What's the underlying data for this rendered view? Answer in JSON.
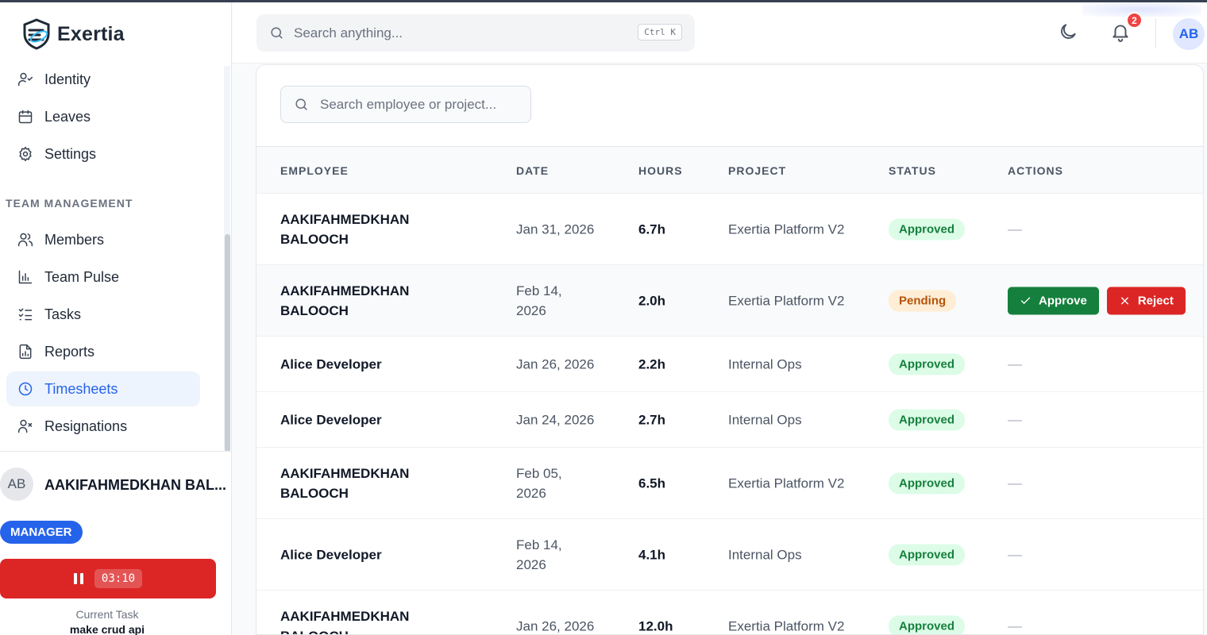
{
  "brand": {
    "name": "Exertia"
  },
  "sidebar": {
    "items_top": [
      {
        "label": "Identity",
        "icon": "user-check-icon"
      },
      {
        "label": "Leaves",
        "icon": "calendar-icon"
      },
      {
        "label": "Settings",
        "icon": "gear-icon"
      }
    ],
    "section_title": "TEAM MANAGEMENT",
    "items": [
      {
        "label": "Members",
        "icon": "users-icon"
      },
      {
        "label": "Team Pulse",
        "icon": "bar-chart-icon"
      },
      {
        "label": "Tasks",
        "icon": "list-checks-icon"
      },
      {
        "label": "Reports",
        "icon": "report-file-icon"
      },
      {
        "label": "Timesheets",
        "icon": "clock-icon",
        "active": true
      },
      {
        "label": "Resignations",
        "icon": "user-x-icon"
      }
    ],
    "user": {
      "initials": "AB",
      "name": "AAKIFAHMEDKHAN BAL...",
      "role": "MANAGER"
    },
    "timer": {
      "time": "03:10",
      "current_task_label": "Current Task",
      "current_task": "make crud api"
    }
  },
  "topbar": {
    "search_placeholder": "Search anything...",
    "shortcut": "Ctrl K",
    "notification_count": "2",
    "avatar_initials": "AB"
  },
  "table": {
    "search_placeholder": "Search employee or project...",
    "columns": [
      "EMPLOYEE",
      "DATE",
      "HOURS",
      "PROJECT",
      "STATUS",
      "ACTIONS"
    ],
    "approve_label": "Approve",
    "reject_label": "Reject",
    "rows": [
      {
        "employee": "AAKIFAHMEDKHAN BALOOCH",
        "date": "Jan 31, 2026",
        "hours": "6.7h",
        "project": "Exertia Platform V2",
        "status": "Approved"
      },
      {
        "employee": "AAKIFAHMEDKHAN BALOOCH",
        "date": "Feb 14, 2026",
        "hours": "2.0h",
        "project": "Exertia Platform V2",
        "status": "Pending"
      },
      {
        "employee": "Alice Developer",
        "date": "Jan 26, 2026",
        "hours": "2.2h",
        "project": "Internal Ops",
        "status": "Approved"
      },
      {
        "employee": "Alice Developer",
        "date": "Jan 24, 2026",
        "hours": "2.7h",
        "project": "Internal Ops",
        "status": "Approved"
      },
      {
        "employee": "AAKIFAHMEDKHAN BALOOCH",
        "date": "Feb 05, 2026",
        "hours": "6.5h",
        "project": "Exertia Platform V2",
        "status": "Approved"
      },
      {
        "employee": "Alice Developer",
        "date": "Feb 14, 2026",
        "hours": "4.1h",
        "project": "Internal Ops",
        "status": "Approved"
      },
      {
        "employee": "AAKIFAHMEDKHAN BALOOCH",
        "date": "Jan 26, 2026",
        "hours": "12.0h",
        "project": "Exertia Platform V2",
        "status": "Approved"
      }
    ]
  },
  "colors": {
    "accent": "#2563eb",
    "approved_bg": "#dcfce7",
    "approved_text": "#15803d",
    "pending_bg": "#ffedd5",
    "pending_text": "#b45309",
    "approve_button": "#15803d",
    "reject_button": "#dc2626"
  }
}
